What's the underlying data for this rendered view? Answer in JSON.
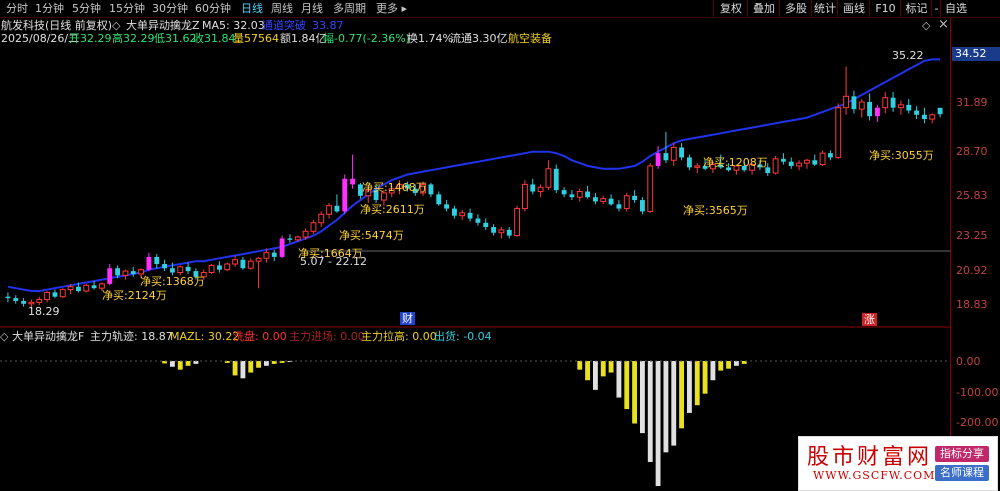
{
  "toolbar": {
    "tabs": [
      {
        "label": "分时",
        "active": false
      },
      {
        "label": "1分钟",
        "active": false
      },
      {
        "label": "5分钟",
        "active": false
      },
      {
        "label": "15分钟",
        "active": false
      },
      {
        "label": "30分钟",
        "active": false
      },
      {
        "label": "60分钟",
        "active": false
      },
      {
        "label": "日线",
        "active": true
      },
      {
        "label": "周线",
        "active": false
      },
      {
        "label": "月线",
        "active": false
      },
      {
        "label": "多周期",
        "active": false
      },
      {
        "label": "更多 ▸",
        "active": false
      }
    ],
    "right_buttons": [
      "复权",
      "叠加",
      "多股",
      "统计",
      "画线",
      "F10",
      "标记",
      "-",
      "自选"
    ]
  },
  "header": {
    "stock_title": "航发科技(日线 前复权)",
    "indicator_name": "大单异动擒龙Z",
    "ma5_label": "MA5: 32.03",
    "upper_label": "通道突破",
    "upper_value": "33.87",
    "date": "2025/08/26/二",
    "open": "开32.29",
    "high": "高32.29",
    "low": "低31.62",
    "close": "收31.84",
    "volume": "量57564",
    "amount": "额1.84亿",
    "change": "幅-0.77(-2.36%)",
    "turnover": "换1.74%",
    "float_cap": "流通3.30亿",
    "sector": "航空装备"
  },
  "price_axis": {
    "current_price": "34.52",
    "labels": [
      "31.89",
      "28.70",
      "25.83",
      "23.25",
      "20.92",
      "18.83"
    ]
  },
  "chart_annotations": {
    "high_marker": "35.22",
    "low_marker": "18.29",
    "range_label": "5.07 - 22.12",
    "net_buy_labels": [
      "净买:2124万",
      "净买:1368万",
      "净买:1664万",
      "净买:5474万",
      "净买:2611万",
      "净买:1468万",
      "净买:3565万",
      "净买:1208万",
      "净买:3055万"
    ],
    "event_markers": [
      "财",
      "涨"
    ]
  },
  "sub_header": {
    "indicator_name": "大单异动擒龙F",
    "track": "主力轨迹: 18.87",
    "mazl": "MAZL: 30.22",
    "wash": "洗盘: 0.00",
    "enter": "主力进场: 0.00",
    "pull": "主力拉高: 0.00",
    "ship": "出货: -0.04"
  },
  "sub_axis": {
    "labels": [
      "0.00",
      "-100.00",
      "-200.00"
    ]
  },
  "watermark": {
    "title": "股市财富网",
    "url": "WWW.GSCFW.COM",
    "tag1": "指标分享",
    "tag2": "名师课程"
  },
  "colors": {
    "bull": "#ff3838",
    "bear": "#30d0e0",
    "upper_band": "#2233ee",
    "net_buy_text": "#ffd23a",
    "signal_bar": "#ff30ff",
    "sub_yellow": "#e8e020",
    "sub_white": "#e0e0e0"
  },
  "chart_data": {
    "type": "candlestick",
    "price_range": [
      17.5,
      36.5
    ],
    "candles": [
      [
        19.0,
        19.3,
        18.6,
        18.9
      ],
      [
        18.9,
        19.1,
        18.5,
        18.7
      ],
      [
        18.7,
        18.9,
        18.3,
        18.5
      ],
      [
        18.5,
        18.8,
        18.2,
        18.6
      ],
      [
        18.6,
        19.0,
        18.4,
        18.8
      ],
      [
        18.8,
        19.4,
        18.6,
        19.3
      ],
      [
        19.3,
        19.5,
        18.9,
        19.0
      ],
      [
        19.0,
        19.6,
        18.9,
        19.5
      ],
      [
        19.5,
        19.9,
        19.2,
        19.7
      ],
      [
        19.7,
        20.0,
        19.3,
        19.4
      ],
      [
        19.4,
        19.9,
        19.3,
        19.8
      ],
      [
        19.8,
        20.1,
        19.5,
        19.6
      ],
      [
        19.6,
        20.0,
        19.4,
        19.9
      ],
      [
        19.9,
        21.3,
        19.8,
        21.0
      ],
      [
        21.0,
        21.2,
        20.3,
        20.5
      ],
      [
        20.5,
        20.9,
        20.2,
        20.8
      ],
      [
        20.8,
        21.1,
        20.4,
        20.6
      ],
      [
        20.6,
        21.0,
        20.3,
        20.9
      ],
      [
        20.9,
        22.1,
        20.8,
        21.8
      ],
      [
        21.8,
        22.0,
        21.0,
        21.3
      ],
      [
        21.3,
        21.6,
        20.8,
        21.0
      ],
      [
        21.0,
        21.4,
        20.5,
        20.7
      ],
      [
        20.7,
        21.2,
        20.5,
        21.1
      ],
      [
        21.1,
        21.4,
        20.6,
        20.8
      ],
      [
        20.8,
        21.0,
        20.2,
        20.4
      ],
      [
        20.4,
        20.9,
        20.2,
        20.7
      ],
      [
        20.7,
        21.3,
        20.6,
        21.2
      ],
      [
        21.2,
        21.5,
        20.7,
        20.9
      ],
      [
        20.9,
        21.4,
        20.8,
        21.3
      ],
      [
        21.3,
        21.9,
        21.1,
        21.6
      ],
      [
        21.6,
        21.8,
        20.9,
        21.0
      ],
      [
        21.0,
        21.7,
        20.9,
        21.5
      ],
      [
        21.5,
        21.8,
        19.6,
        21.7
      ],
      [
        21.7,
        22.4,
        21.4,
        22.1
      ],
      [
        22.1,
        22.3,
        21.5,
        21.8
      ],
      [
        21.8,
        23.3,
        21.7,
        23.1
      ],
      [
        23.1,
        23.4,
        22.8,
        23.0
      ],
      [
        23.0,
        23.3,
        22.9,
        23.2
      ],
      [
        23.2,
        23.8,
        23.0,
        23.6
      ],
      [
        23.6,
        24.4,
        23.4,
        24.2
      ],
      [
        24.2,
        25.0,
        23.9,
        24.8
      ],
      [
        24.8,
        25.6,
        24.5,
        25.4
      ],
      [
        25.4,
        26.2,
        24.9,
        25.0
      ],
      [
        25.0,
        27.6,
        24.8,
        27.3
      ],
      [
        27.3,
        29.0,
        26.6,
        26.9
      ],
      [
        26.9,
        27.0,
        25.9,
        26.1
      ],
      [
        26.1,
        26.7,
        25.6,
        26.5
      ],
      [
        26.5,
        26.9,
        25.6,
        25.8
      ],
      [
        25.8,
        26.5,
        25.4,
        26.3
      ],
      [
        26.3,
        26.8,
        26.0,
        26.6
      ],
      [
        26.6,
        27.2,
        26.2,
        26.9
      ],
      [
        26.9,
        27.1,
        26.4,
        26.6
      ],
      [
        26.6,
        26.9,
        26.1,
        26.3
      ],
      [
        26.3,
        27.1,
        26.1,
        26.9
      ],
      [
        26.9,
        27.0,
        26.0,
        26.2
      ],
      [
        26.2,
        26.4,
        25.4,
        25.5
      ],
      [
        25.5,
        25.8,
        25.0,
        25.2
      ],
      [
        25.2,
        25.4,
        24.5,
        24.7
      ],
      [
        24.7,
        25.1,
        24.4,
        24.9
      ],
      [
        24.9,
        25.2,
        24.3,
        24.5
      ],
      [
        24.5,
        24.8,
        24.0,
        24.2
      ],
      [
        24.2,
        24.5,
        23.7,
        23.9
      ],
      [
        23.9,
        24.1,
        23.3,
        23.5
      ],
      [
        23.5,
        23.9,
        23.1,
        23.7
      ],
      [
        23.7,
        23.9,
        23.1,
        23.3
      ],
      [
        23.3,
        25.4,
        23.2,
        25.2
      ],
      [
        25.2,
        27.2,
        25.0,
        26.9
      ],
      [
        26.9,
        27.3,
        26.2,
        26.4
      ],
      [
        26.4,
        26.9,
        26.0,
        26.7
      ],
      [
        26.7,
        28.6,
        26.5,
        28.0
      ],
      [
        28.0,
        28.3,
        26.3,
        26.5
      ],
      [
        26.5,
        26.7,
        26.0,
        26.2
      ],
      [
        26.2,
        26.5,
        25.8,
        26.0
      ],
      [
        26.0,
        26.6,
        25.7,
        26.4
      ],
      [
        26.4,
        26.8,
        25.9,
        26.0
      ],
      [
        26.0,
        26.3,
        25.5,
        25.7
      ],
      [
        25.7,
        26.1,
        25.5,
        25.9
      ],
      [
        25.9,
        26.2,
        25.4,
        25.5
      ],
      [
        25.5,
        25.8,
        25.0,
        25.2
      ],
      [
        25.2,
        26.3,
        25.0,
        26.1
      ],
      [
        26.1,
        26.5,
        25.6,
        25.8
      ],
      [
        25.8,
        26.0,
        24.8,
        25.0
      ],
      [
        25.0,
        28.4,
        24.9,
        28.2
      ],
      [
        28.2,
        29.6,
        28.0,
        29.1
      ],
      [
        29.1,
        30.6,
        28.4,
        28.6
      ],
      [
        28.6,
        29.8,
        28.2,
        29.5
      ],
      [
        29.5,
        29.8,
        28.6,
        28.8
      ],
      [
        28.8,
        29.0,
        27.9,
        28.1
      ],
      [
        28.1,
        28.4,
        27.7,
        28.2
      ],
      [
        28.2,
        28.7,
        27.9,
        28.0
      ],
      [
        28.0,
        28.5,
        27.7,
        28.3
      ],
      [
        28.3,
        29.0,
        28.0,
        28.1
      ],
      [
        28.1,
        28.4,
        27.8,
        27.9
      ],
      [
        27.9,
        28.3,
        27.6,
        28.2
      ],
      [
        28.2,
        28.5,
        27.8,
        27.9
      ],
      [
        27.9,
        28.4,
        27.6,
        28.3
      ],
      [
        28.3,
        28.6,
        27.9,
        28.1
      ],
      [
        28.1,
        28.4,
        27.5,
        27.7
      ],
      [
        27.7,
        28.9,
        27.6,
        28.7
      ],
      [
        28.7,
        29.1,
        28.3,
        28.5
      ],
      [
        28.5,
        28.8,
        28.0,
        28.2
      ],
      [
        28.2,
        28.6,
        27.9,
        28.4
      ],
      [
        28.4,
        28.7,
        28.0,
        28.6
      ],
      [
        28.6,
        29.0,
        28.2,
        28.3
      ],
      [
        28.3,
        29.3,
        28.2,
        29.1
      ],
      [
        29.1,
        29.3,
        28.6,
        28.8
      ],
      [
        28.8,
        32.6,
        28.7,
        32.3
      ],
      [
        32.3,
        35.2,
        31.8,
        33.1
      ],
      [
        33.1,
        33.5,
        31.9,
        32.2
      ],
      [
        32.2,
        32.9,
        31.6,
        32.7
      ],
      [
        32.7,
        33.3,
        31.4,
        31.7
      ],
      [
        31.7,
        32.5,
        31.3,
        32.3
      ],
      [
        32.3,
        33.4,
        31.9,
        33.0
      ],
      [
        33.0,
        33.4,
        32.0,
        32.3
      ],
      [
        32.3,
        32.8,
        31.8,
        32.5
      ],
      [
        32.5,
        32.9,
        31.9,
        32.1
      ],
      [
        32.1,
        32.4,
        31.5,
        31.8
      ],
      [
        31.8,
        32.3,
        31.2,
        31.5
      ],
      [
        31.5,
        31.9,
        31.2,
        31.8
      ],
      [
        32.29,
        32.29,
        31.62,
        31.84
      ]
    ],
    "signal_indices": [
      13,
      18,
      35,
      43,
      44,
      83,
      111
    ],
    "upper_band": [
      19.7,
      19.6,
      19.5,
      19.4,
      19.4,
      19.5,
      19.6,
      19.7,
      19.8,
      19.9,
      20.0,
      20.1,
      20.2,
      20.3,
      20.4,
      20.5,
      20.6,
      20.7,
      20.9,
      21.0,
      21.1,
      21.2,
      21.3,
      21.4,
      21.5,
      21.5,
      21.6,
      21.7,
      21.8,
      21.9,
      22.0,
      22.1,
      22.2,
      22.3,
      22.4,
      22.5,
      22.7,
      22.9,
      23.1,
      23.3,
      23.6,
      24.0,
      24.4,
      24.9,
      25.4,
      25.8,
      26.2,
      26.6,
      26.9,
      27.2,
      27.4,
      27.6,
      27.7,
      27.8,
      27.9,
      28.0,
      28.1,
      28.2,
      28.3,
      28.4,
      28.5,
      28.6,
      28.7,
      28.8,
      28.9,
      29.0,
      29.1,
      29.2,
      29.2,
      29.2,
      29.1,
      28.9,
      28.6,
      28.4,
      28.2,
      28.1,
      28.0,
      28.0,
      28.0,
      28.1,
      28.2,
      28.5,
      28.9,
      29.2,
      29.5,
      29.8,
      30.0,
      30.1,
      30.2,
      30.3,
      30.4,
      30.5,
      30.6,
      30.7,
      30.8,
      30.9,
      31.0,
      31.1,
      31.2,
      31.3,
      31.4,
      31.5,
      31.6,
      31.8,
      32.0,
      32.2,
      32.4,
      32.6,
      32.9,
      33.2,
      33.5,
      33.8,
      34.1,
      34.4,
      34.7,
      35.0,
      35.3,
      35.6,
      35.7,
      35.7
    ],
    "sub_bars": [
      0,
      0,
      0,
      0,
      0,
      0,
      0,
      0,
      0,
      0,
      0,
      0,
      0,
      0,
      0,
      0,
      0,
      0,
      0,
      0,
      -5,
      -12,
      -18,
      -10,
      -6,
      0,
      0,
      0,
      -4,
      -30,
      -36,
      -24,
      -14,
      -10,
      -6,
      -4,
      -2,
      0,
      0,
      0,
      0,
      0,
      0,
      0,
      0,
      0,
      0,
      0,
      0,
      0,
      0,
      0,
      0,
      0,
      0,
      0,
      0,
      0,
      0,
      0,
      0,
      0,
      0,
      0,
      0,
      0,
      0,
      0,
      0,
      0,
      0,
      0,
      0,
      -18,
      -40,
      -60,
      -32,
      -24,
      -76,
      -100,
      -130,
      -150,
      -210,
      -260,
      -190,
      -176,
      -140,
      -108,
      -92,
      -68,
      -40,
      -20,
      -16,
      -10,
      -6,
      0,
      0,
      0,
      0,
      0,
      0,
      0,
      0,
      0,
      0,
      0,
      0,
      0,
      0,
      0,
      0,
      0,
      0,
      0,
      0,
      0,
      0,
      0,
      0,
      0
    ]
  }
}
